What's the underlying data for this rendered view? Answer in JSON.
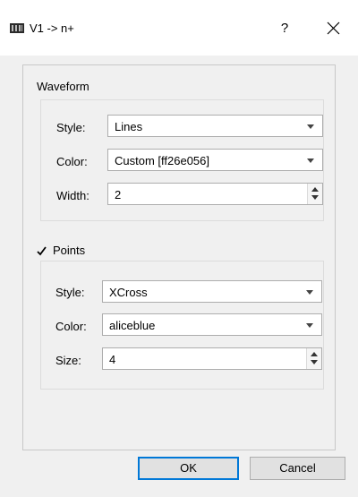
{
  "window": {
    "title": "V1 -> n+",
    "help_label": "?",
    "icon": "waveform-app-icon",
    "close_icon": "close-icon"
  },
  "waveform": {
    "heading": "Waveform",
    "style_label": "Style:",
    "style_value": "Lines",
    "color_label": "Color:",
    "color_value": "Custom [ff26e056]",
    "width_label": "Width:",
    "width_value": "2"
  },
  "points": {
    "enabled_label": "Points",
    "checked": true,
    "style_label": "Style:",
    "style_value": "XCross",
    "color_label": "Color:",
    "color_value": "aliceblue",
    "size_label": "Size:",
    "size_value": "4"
  },
  "buttons": {
    "ok_label": "OK",
    "cancel_label": "Cancel"
  },
  "colors": {
    "accent": "#0078d7",
    "dialog_bg": "#f0f0f0"
  }
}
